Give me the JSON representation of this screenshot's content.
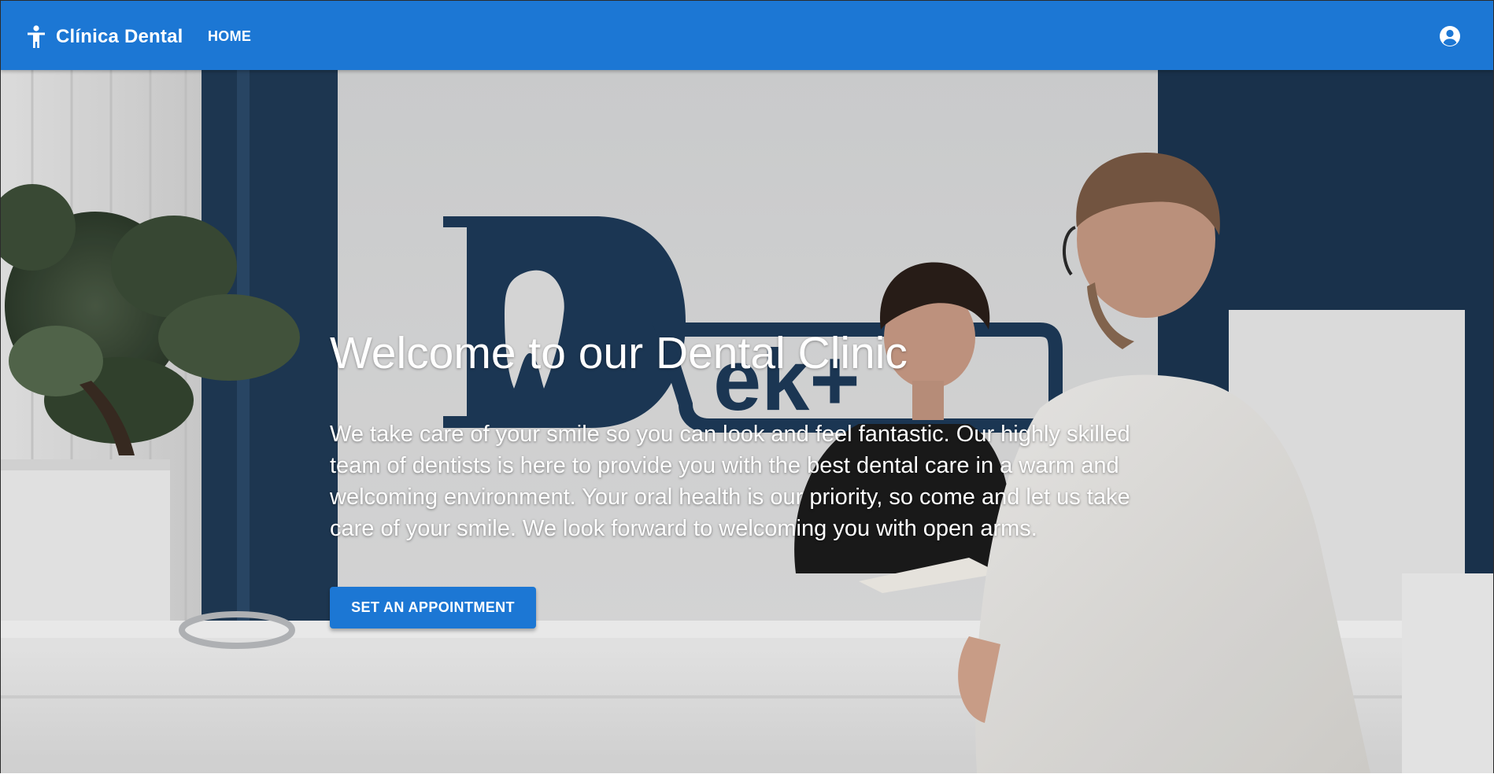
{
  "appbar": {
    "brand_icon": "accessibility-person-icon",
    "brand_title": "Clínica Dental",
    "nav_home_label": "HOME",
    "account_icon": "account-circle-icon",
    "color": "#1c77d4"
  },
  "hero": {
    "background_image": "reception-desk-photo",
    "title": "Welcome to our Dental Clinic",
    "description": "We take care of your smile so you can look and feel fantastic. Our highly skilled team of dentists is here to provide you with the best dental care in a warm and welcoming environment. Your oral health is our priority, so come and let us take care of your smile. We look forward to welcoming you with open arms.",
    "cta_label": "SET AN APPOINTMENT",
    "cta_color": "#1c77d4"
  }
}
